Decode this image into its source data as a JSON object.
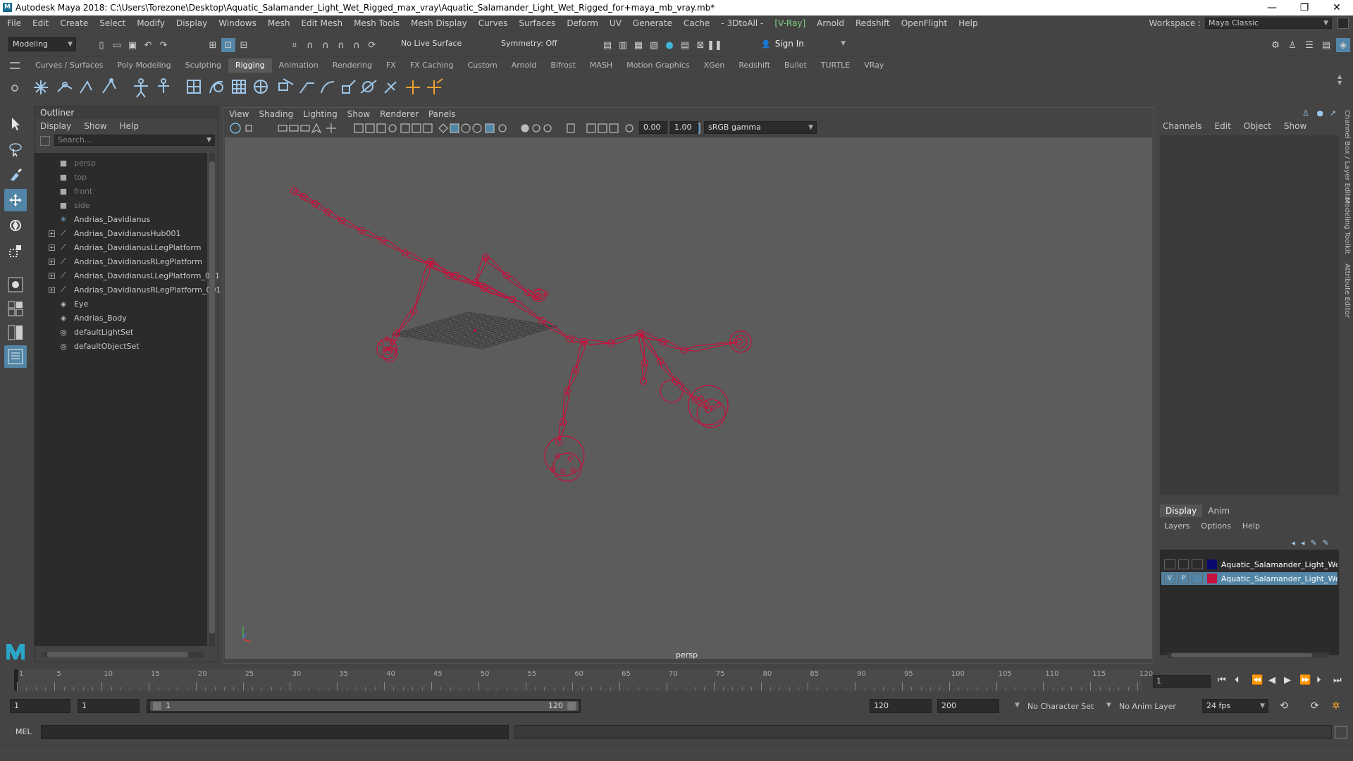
{
  "window": {
    "title": "Autodesk Maya 2018: C:\\Users\\Torezone\\Desktop\\Aquatic_Salamander_Light_Wet_Rigged_max_vray\\Aquatic_Salamander_Light_Wet_Rigged_for+maya_mb_vray.mb*",
    "app_icon": "M",
    "minimize": "—",
    "maximize": "❐",
    "close": "✕"
  },
  "menubar": {
    "items": [
      "File",
      "Edit",
      "Create",
      "Select",
      "Modify",
      "Display",
      "Windows",
      "Mesh",
      "Edit Mesh",
      "Mesh Tools",
      "Mesh Display",
      "Curves",
      "Surfaces",
      "Deform",
      "UV",
      "Generate",
      "Cache",
      "- 3DtoAll -",
      "[V-Ray]",
      "Arnold",
      "Redshift",
      "OpenFlight",
      "Help"
    ],
    "workspace_label": "Workspace :",
    "workspace_value": "Maya Classic"
  },
  "statusline": {
    "mode": "Modeling",
    "live_surface": "No Live Surface",
    "symmetry": "Symmetry: Off",
    "sign_in": "Sign In"
  },
  "shelf": {
    "tabs": [
      "Curves / Surfaces",
      "Poly Modeling",
      "Sculpting",
      "Rigging",
      "Animation",
      "Rendering",
      "FX",
      "FX Caching",
      "Custom",
      "Arnold",
      "Bifrost",
      "MASH",
      "Motion Graphics",
      "XGen",
      "Redshift",
      "Bullet",
      "TURTLE",
      "VRay"
    ],
    "active_tab": "Rigging"
  },
  "outliner": {
    "title": "Outliner",
    "menu": [
      "Display",
      "Show",
      "Help"
    ],
    "search_placeholder": "Search...",
    "items": [
      {
        "label": "persp",
        "icon": "camera-icon",
        "dim": true,
        "expand": false
      },
      {
        "label": "top",
        "icon": "camera-icon",
        "dim": true,
        "expand": false
      },
      {
        "label": "front",
        "icon": "camera-icon",
        "dim": true,
        "expand": false
      },
      {
        "label": "side",
        "icon": "camera-icon",
        "dim": true,
        "expand": false
      },
      {
        "label": "Andrias_Davidianus",
        "icon": "joint-icon",
        "dim": false,
        "expand": false
      },
      {
        "label": "Andrias_DavidianusHub001",
        "icon": "skeleton-icon",
        "dim": false,
        "expand": true
      },
      {
        "label": "Andrias_DavidianusLLegPlatform",
        "icon": "skeleton-icon",
        "dim": false,
        "expand": true
      },
      {
        "label": "Andrias_DavidianusRLegPlatform",
        "icon": "skeleton-icon",
        "dim": false,
        "expand": true
      },
      {
        "label": "Andrias_DavidianusLLegPlatform_001",
        "icon": "skeleton-icon",
        "dim": false,
        "expand": true
      },
      {
        "label": "Andrias_DavidianusRLegPlatform_001",
        "icon": "skeleton-icon",
        "dim": false,
        "expand": true
      },
      {
        "label": "Eye",
        "icon": "mesh-icon",
        "dim": false,
        "expand": false
      },
      {
        "label": "Andrias_Body",
        "icon": "mesh-icon",
        "dim": false,
        "expand": false
      },
      {
        "label": "defaultLightSet",
        "icon": "set-icon",
        "dim": false,
        "expand": false
      },
      {
        "label": "defaultObjectSet",
        "icon": "set-icon",
        "dim": false,
        "expand": false
      }
    ]
  },
  "viewport": {
    "menu": [
      "View",
      "Shading",
      "Lighting",
      "Show",
      "Renderer",
      "Panels"
    ],
    "exposure": "0.00",
    "gamma": "1.00",
    "color_space": "sRGB gamma",
    "camera_label": "persp",
    "rig_color": "#c8103c"
  },
  "channelbox": {
    "menu": [
      "Channels",
      "Edit",
      "Object",
      "Show"
    ],
    "layer_tabs": [
      "Display",
      "Anim"
    ],
    "active_layer_tab": "Display",
    "layer_menu": [
      "Layers",
      "Options",
      "Help"
    ],
    "layers": [
      {
        "v": "",
        "p": "",
        "color": "#0a0a6e",
        "name": "Aquatic_Salamander_Light_We",
        "selected": false
      },
      {
        "v": "V",
        "p": "P",
        "color": "#c8103c",
        "name": "Aquatic_Salamander_Light_We",
        "selected": true
      }
    ],
    "side_tabs": [
      "Channel Box / Layer Editor",
      "Modeling Toolkit",
      "Attribute Editor"
    ]
  },
  "timeslider": {
    "ticks": [
      1,
      5,
      10,
      15,
      20,
      25,
      30,
      35,
      40,
      45,
      50,
      55,
      60,
      65,
      70,
      75,
      80,
      85,
      90,
      95,
      100,
      105,
      110,
      115,
      120
    ],
    "current_frame": "1"
  },
  "rangeslider": {
    "start": "1",
    "playback_start": "1",
    "range_start_label": "1",
    "range_end_label": "120",
    "playback_end": "120",
    "end": "200",
    "character_set": "No Character Set",
    "anim_layer": "No Anim Layer",
    "fps": "24 fps"
  },
  "cmdline": {
    "label": "MEL"
  }
}
